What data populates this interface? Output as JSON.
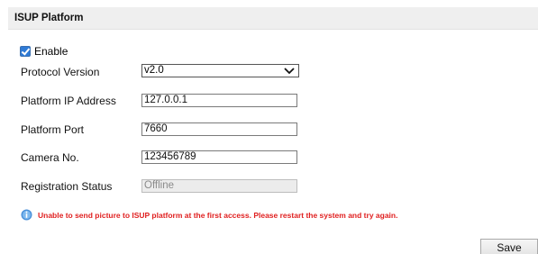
{
  "header": {
    "title": "ISUP Platform"
  },
  "enable": {
    "label": "Enable",
    "checked": true
  },
  "protocol_version": {
    "label": "Protocol Version",
    "value": "v2.0"
  },
  "platform_ip": {
    "label": "Platform IP Address",
    "value": "127.0.0.1"
  },
  "platform_port": {
    "label": "Platform Port",
    "value": "7660"
  },
  "camera_no": {
    "label": "Camera No.",
    "value": "123456789"
  },
  "registration_status": {
    "label": "Registration Status",
    "value": "Offline"
  },
  "notice": {
    "text": "Unable to send picture to ISUP platform at the first access. Please restart the system and try again.",
    "color": "#e02020"
  },
  "save": {
    "label": "Save"
  },
  "colors": {
    "accent": "#2f7bd6",
    "header_bg": "#efefef"
  },
  "icons": {
    "notice": "info-icon",
    "dropdown": "chevron-down-icon",
    "checkbox": "checkmark-icon"
  }
}
